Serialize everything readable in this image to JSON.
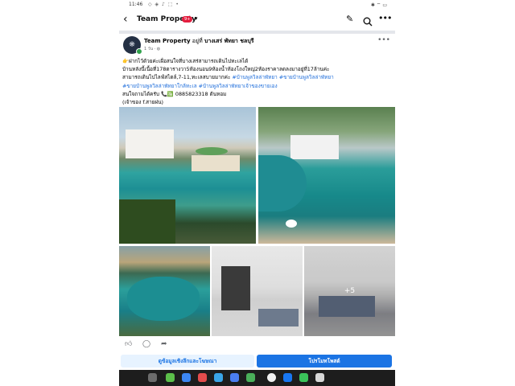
{
  "status_bar": {
    "time": "11:46"
  },
  "app_bar": {
    "title": "Team Property",
    "badge": "9+"
  },
  "post": {
    "page_name": "Team Property",
    "location_prefix": "อยู่ที่",
    "location": "บางเสร่ พัทยา ชลบุรี",
    "time": "1 วัน",
    "text_lines": [
      [
        {
          "t": "👉ฝากไว้ด้วยค่ะเผื่อสนใจที่บางเสร่สามารถเดินไปทะเลได้",
          "tag": false
        }
      ],
      [
        {
          "t": "บ้านหลังนี้เนื้อที่178ตารางวา5ห้องนอน9ห้องน้ำห้องโถงใหญ่2ห้องราคาลดลงมาอยู่ที่17ล้านค่ะ",
          "tag": false
        }
      ],
      [
        {
          "t": "สามารถเดินไปไลฟ์สไตล์,7-11,ทะเลสบายมากค่ะ ",
          "tag": false
        },
        {
          "t": "#บ้านพูลวิลล่าพัทยา #ขายบ้านพูลวิลล่าพัทยา",
          "tag": true
        }
      ],
      [
        {
          "t": "#ขายบ้านพูลวิลล่าพัทยาใกล้ทะเล #บ้านพูลวิลล่าพัทยาเจ้าของขายเอง",
          "tag": true
        }
      ],
      [
        {
          "t": "สนใจถามได้ครับ 📞🈯 0885823318 ต้นหอม",
          "tag": false
        }
      ],
      [
        {
          "t": "(เจ้าของ f.สายฝน)",
          "tag": false
        }
      ]
    ],
    "more_photos": "+5"
  },
  "buttons": {
    "insights": "ดูข้อมูลเชิงลึกและโฆษณา",
    "promote": "โปรโมทโพสต์"
  },
  "colors": {
    "facebook_blue": "#1b74e4",
    "hashtag": "#216fdb",
    "badge_red": "#e41e3f",
    "taskbar": "#1d1d1d"
  }
}
